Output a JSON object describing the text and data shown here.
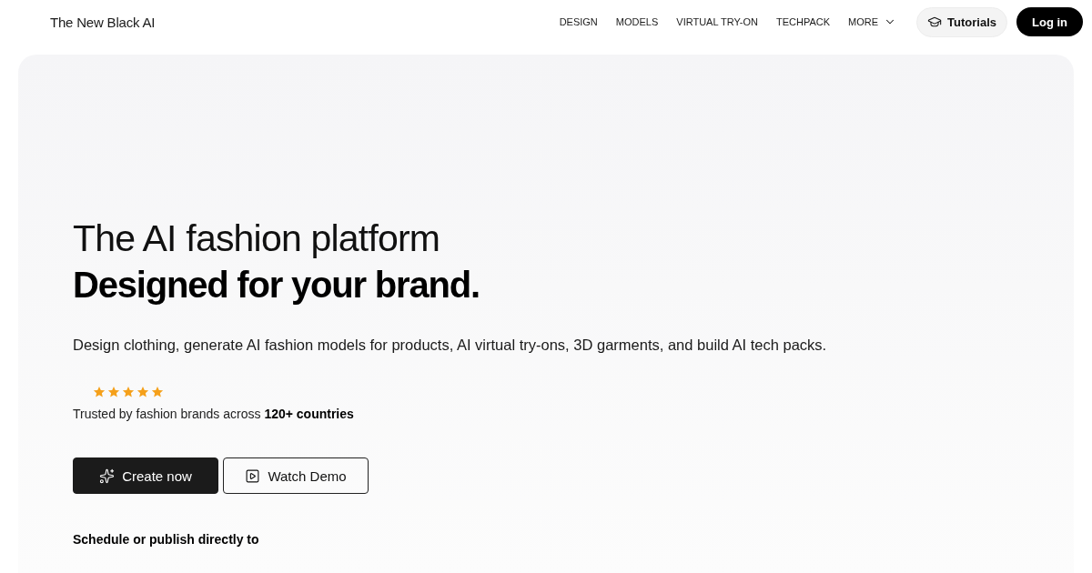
{
  "header": {
    "logo": "The New Black AI",
    "nav": [
      {
        "label": "DESIGN",
        "has_menu": false
      },
      {
        "label": "MODELS",
        "has_menu": false
      },
      {
        "label": "VIRTUAL TRY-ON",
        "has_menu": false
      },
      {
        "label": "TECHPACK",
        "has_menu": false
      },
      {
        "label": "MORE",
        "has_menu": true
      }
    ],
    "tutorials": "Tutorials",
    "login": "Log in"
  },
  "hero": {
    "title": "The AI fashion platform",
    "subtitle": "Designed for your brand.",
    "description": "Design clothing, generate AI fashion models for products, AI virtual try-ons, 3D garments, and build AI tech packs.",
    "rating": {
      "stars": 5
    },
    "trust": "Trusted by fashion brands across **120+ countries**",
    "buttons": [
      {
        "label": "Create now",
        "kind": "primary"
      },
      {
        "label": "Watch Demo",
        "kind": "secondary"
      }
    ],
    "publish_heading": "Schedule or publish directly to"
  }
}
